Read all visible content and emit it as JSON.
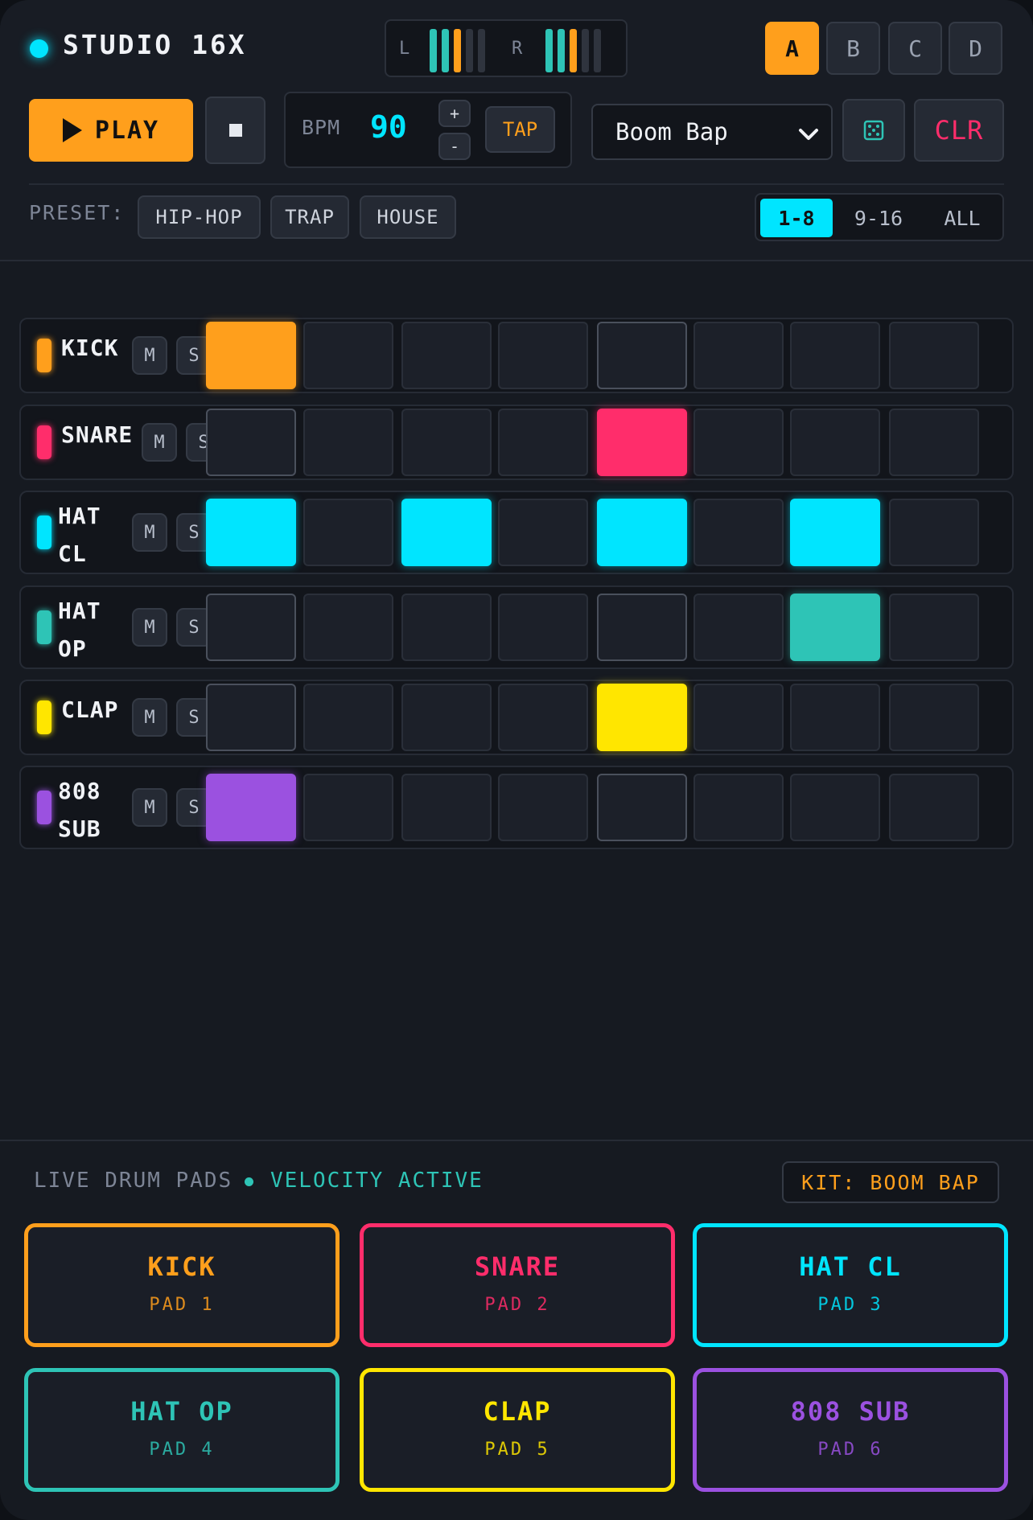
{
  "app": {
    "title": "STUDIO 16X"
  },
  "meter": {
    "left_label": "L",
    "right_label": "R"
  },
  "banks": [
    "A",
    "B",
    "C",
    "D"
  ],
  "active_bank": "A",
  "transport": {
    "play_label": "PLAY"
  },
  "bpm": {
    "label": "BPM",
    "value": "90",
    "plus": "+",
    "minus": "-",
    "tap": "TAP"
  },
  "kit_select": {
    "value": "Boom Bap"
  },
  "clear_label": "CLR",
  "presets": {
    "label": "PRESET:",
    "items": [
      "HIP-HOP",
      "TRAP",
      "HOUSE"
    ]
  },
  "pages": {
    "items": [
      "1-8",
      "9-16",
      "ALL"
    ],
    "active": "1-8"
  },
  "mute_label": "M",
  "solo_label": "S",
  "tracks": [
    {
      "name_lines": [
        "KICK"
      ],
      "color": "#ff9f1c",
      "steps": [
        1,
        0,
        0,
        0,
        0,
        0,
        0,
        0
      ]
    },
    {
      "name_lines": [
        "SNARE"
      ],
      "color": "#ff2d6b",
      "steps": [
        0,
        0,
        0,
        0,
        1,
        0,
        0,
        0
      ]
    },
    {
      "name_lines": [
        "HAT",
        "CL"
      ],
      "color": "#00e5ff",
      "steps": [
        1,
        0,
        1,
        0,
        1,
        0,
        1,
        0
      ]
    },
    {
      "name_lines": [
        "HAT",
        "OP"
      ],
      "color": "#2ec4b6",
      "steps": [
        0,
        0,
        0,
        0,
        0,
        0,
        1,
        0
      ]
    },
    {
      "name_lines": [
        "CLAP"
      ],
      "color": "#ffe600",
      "steps": [
        0,
        0,
        0,
        0,
        1,
        0,
        0,
        0
      ]
    },
    {
      "name_lines": [
        "808",
        "SUB"
      ],
      "color": "#9b51e0",
      "steps": [
        1,
        0,
        0,
        0,
        0,
        0,
        0,
        0
      ]
    }
  ],
  "pads_section": {
    "label": "LIVE DRUM PADS",
    "velocity": "VELOCITY ACTIVE",
    "kit": "KIT: BOOM BAP",
    "pads": [
      {
        "name": "KICK",
        "sub": "PAD 1",
        "color": "#ff9f1c"
      },
      {
        "name": "SNARE",
        "sub": "PAD 2",
        "color": "#ff2d6b"
      },
      {
        "name": "HAT CL",
        "sub": "PAD 3",
        "color": "#00e5ff"
      },
      {
        "name": "HAT OP",
        "sub": "PAD 4",
        "color": "#2ec4b6"
      },
      {
        "name": "CLAP",
        "sub": "PAD 5",
        "color": "#ffe600"
      },
      {
        "name": "808 SUB",
        "sub": "PAD 6",
        "color": "#9b51e0"
      }
    ]
  }
}
